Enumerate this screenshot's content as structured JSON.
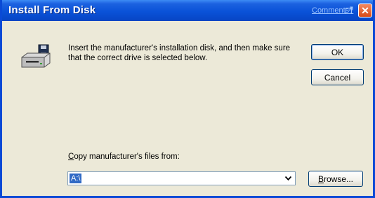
{
  "window": {
    "title": "Install From Disk",
    "comments_link": "Comments?",
    "close_symbol": "✕"
  },
  "message": "Insert the manufacturer's installation disk, and then make sure that the correct drive is selected below.",
  "buttons": {
    "ok": "OK",
    "cancel": "Cancel",
    "browse_prefix": "B",
    "browse_rest": "rowse..."
  },
  "copy_from": {
    "label_prefix": "C",
    "label_rest": "opy manufacturer's files from:",
    "value": "A:\\"
  },
  "colors": {
    "titlebar": "#0a52d8",
    "selection": "#316ac5",
    "close": "#d94a16"
  }
}
